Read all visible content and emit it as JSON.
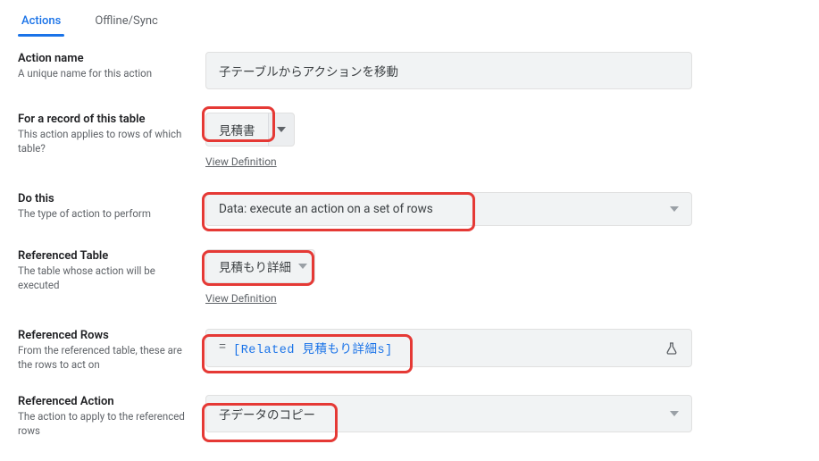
{
  "tabs": {
    "actions": "Actions",
    "offline": "Offline/Sync"
  },
  "actionName": {
    "title": "Action name",
    "desc": "A unique name for this action",
    "value": "子テーブルからアクションを移動"
  },
  "forRecord": {
    "title": "For a record of this table",
    "desc": "This action applies to rows of which table?",
    "value": "見積書",
    "viewDef": "View Definition"
  },
  "doThis": {
    "title": "Do this",
    "desc": "The type of action to perform",
    "value": "Data: execute an action on a set of rows"
  },
  "refTable": {
    "title": "Referenced Table",
    "desc": "The table whose action will be executed",
    "value": "見積もり詳細",
    "viewDef": "View Definition"
  },
  "refRows": {
    "title": "Referenced Rows",
    "desc": "From the referenced table, these are the rows to act on",
    "expr": "[Related 見積もり詳細s]"
  },
  "refAction": {
    "title": "Referenced Action",
    "desc": "The action to apply to the referenced rows",
    "value": "子データのコピー"
  }
}
